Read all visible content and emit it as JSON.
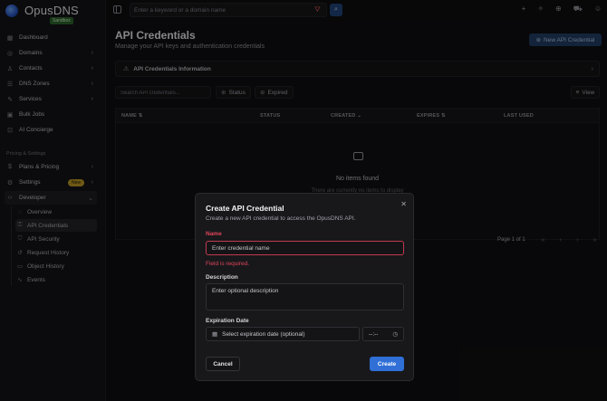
{
  "app": {
    "name": "OpusDNS",
    "env_badge": "Sandbox"
  },
  "topbar": {
    "search_placeholder": "Enter a keyword or a domain name",
    "icons": [
      "sidebar-toggle-icon",
      "filter-icon",
      "search-icon",
      "plus-icon",
      "sparkle-icon",
      "globe-icon",
      "cart-icon",
      "user-icon"
    ]
  },
  "sidebar": {
    "items": [
      {
        "label": "Dashboard",
        "icon": "dashboard-icon"
      },
      {
        "label": "Domains",
        "icon": "globe-icon"
      },
      {
        "label": "Contacts",
        "icon": "contacts-icon"
      },
      {
        "label": "DNS Zones",
        "icon": "server-icon"
      },
      {
        "label": "Services",
        "icon": "wrench-icon"
      },
      {
        "label": "Bulk Jobs",
        "icon": "box-icon"
      },
      {
        "label": "AI Concierge",
        "icon": "bot-icon"
      }
    ],
    "section_label": "Pricing & Settings",
    "settings_items": [
      {
        "label": "Plans & Pricing",
        "icon": "dollar-icon"
      },
      {
        "label": "Settings",
        "icon": "gear-icon",
        "badge": "New"
      },
      {
        "label": "Developer",
        "icon": "code-icon"
      }
    ],
    "developer_sub": [
      {
        "label": "Overview"
      },
      {
        "label": "API Credentials"
      },
      {
        "label": "API Security"
      },
      {
        "label": "Request History"
      },
      {
        "label": "Object History"
      },
      {
        "label": "Events"
      }
    ]
  },
  "main": {
    "title": "API Credentials",
    "subtitle": "Manage your API keys and authentication credentials",
    "new_button": "New API Credential",
    "info_bar": "API Credentials Information",
    "filter_placeholder": "Search API credentials...",
    "chips": [
      "Status",
      "Expired"
    ],
    "view_button": "View",
    "columns": [
      "NAME",
      "STATUS",
      "CREATED",
      "EXPIRES",
      "LAST USED"
    ],
    "empty_title": "No items found",
    "empty_sub": "There are currently no items to display",
    "pager_label": "Page 1 of 1"
  },
  "modal": {
    "title": "Create API Credential",
    "description": "Create a new API credential to access the OpusDNS API.",
    "name_label": "Name",
    "name_placeholder": "Enter credential name",
    "name_error": "Field is required.",
    "desc_label": "Description",
    "desc_placeholder": "Enter optional description",
    "date_label": "Expiration Date",
    "date_button": "Select expiration date (optional)",
    "time_value": "--:--",
    "cancel": "Cancel",
    "create": "Create"
  },
  "colors": {
    "accent": "#2f6fd6",
    "error": "#e0455a",
    "badge_new": "#c9a227"
  }
}
